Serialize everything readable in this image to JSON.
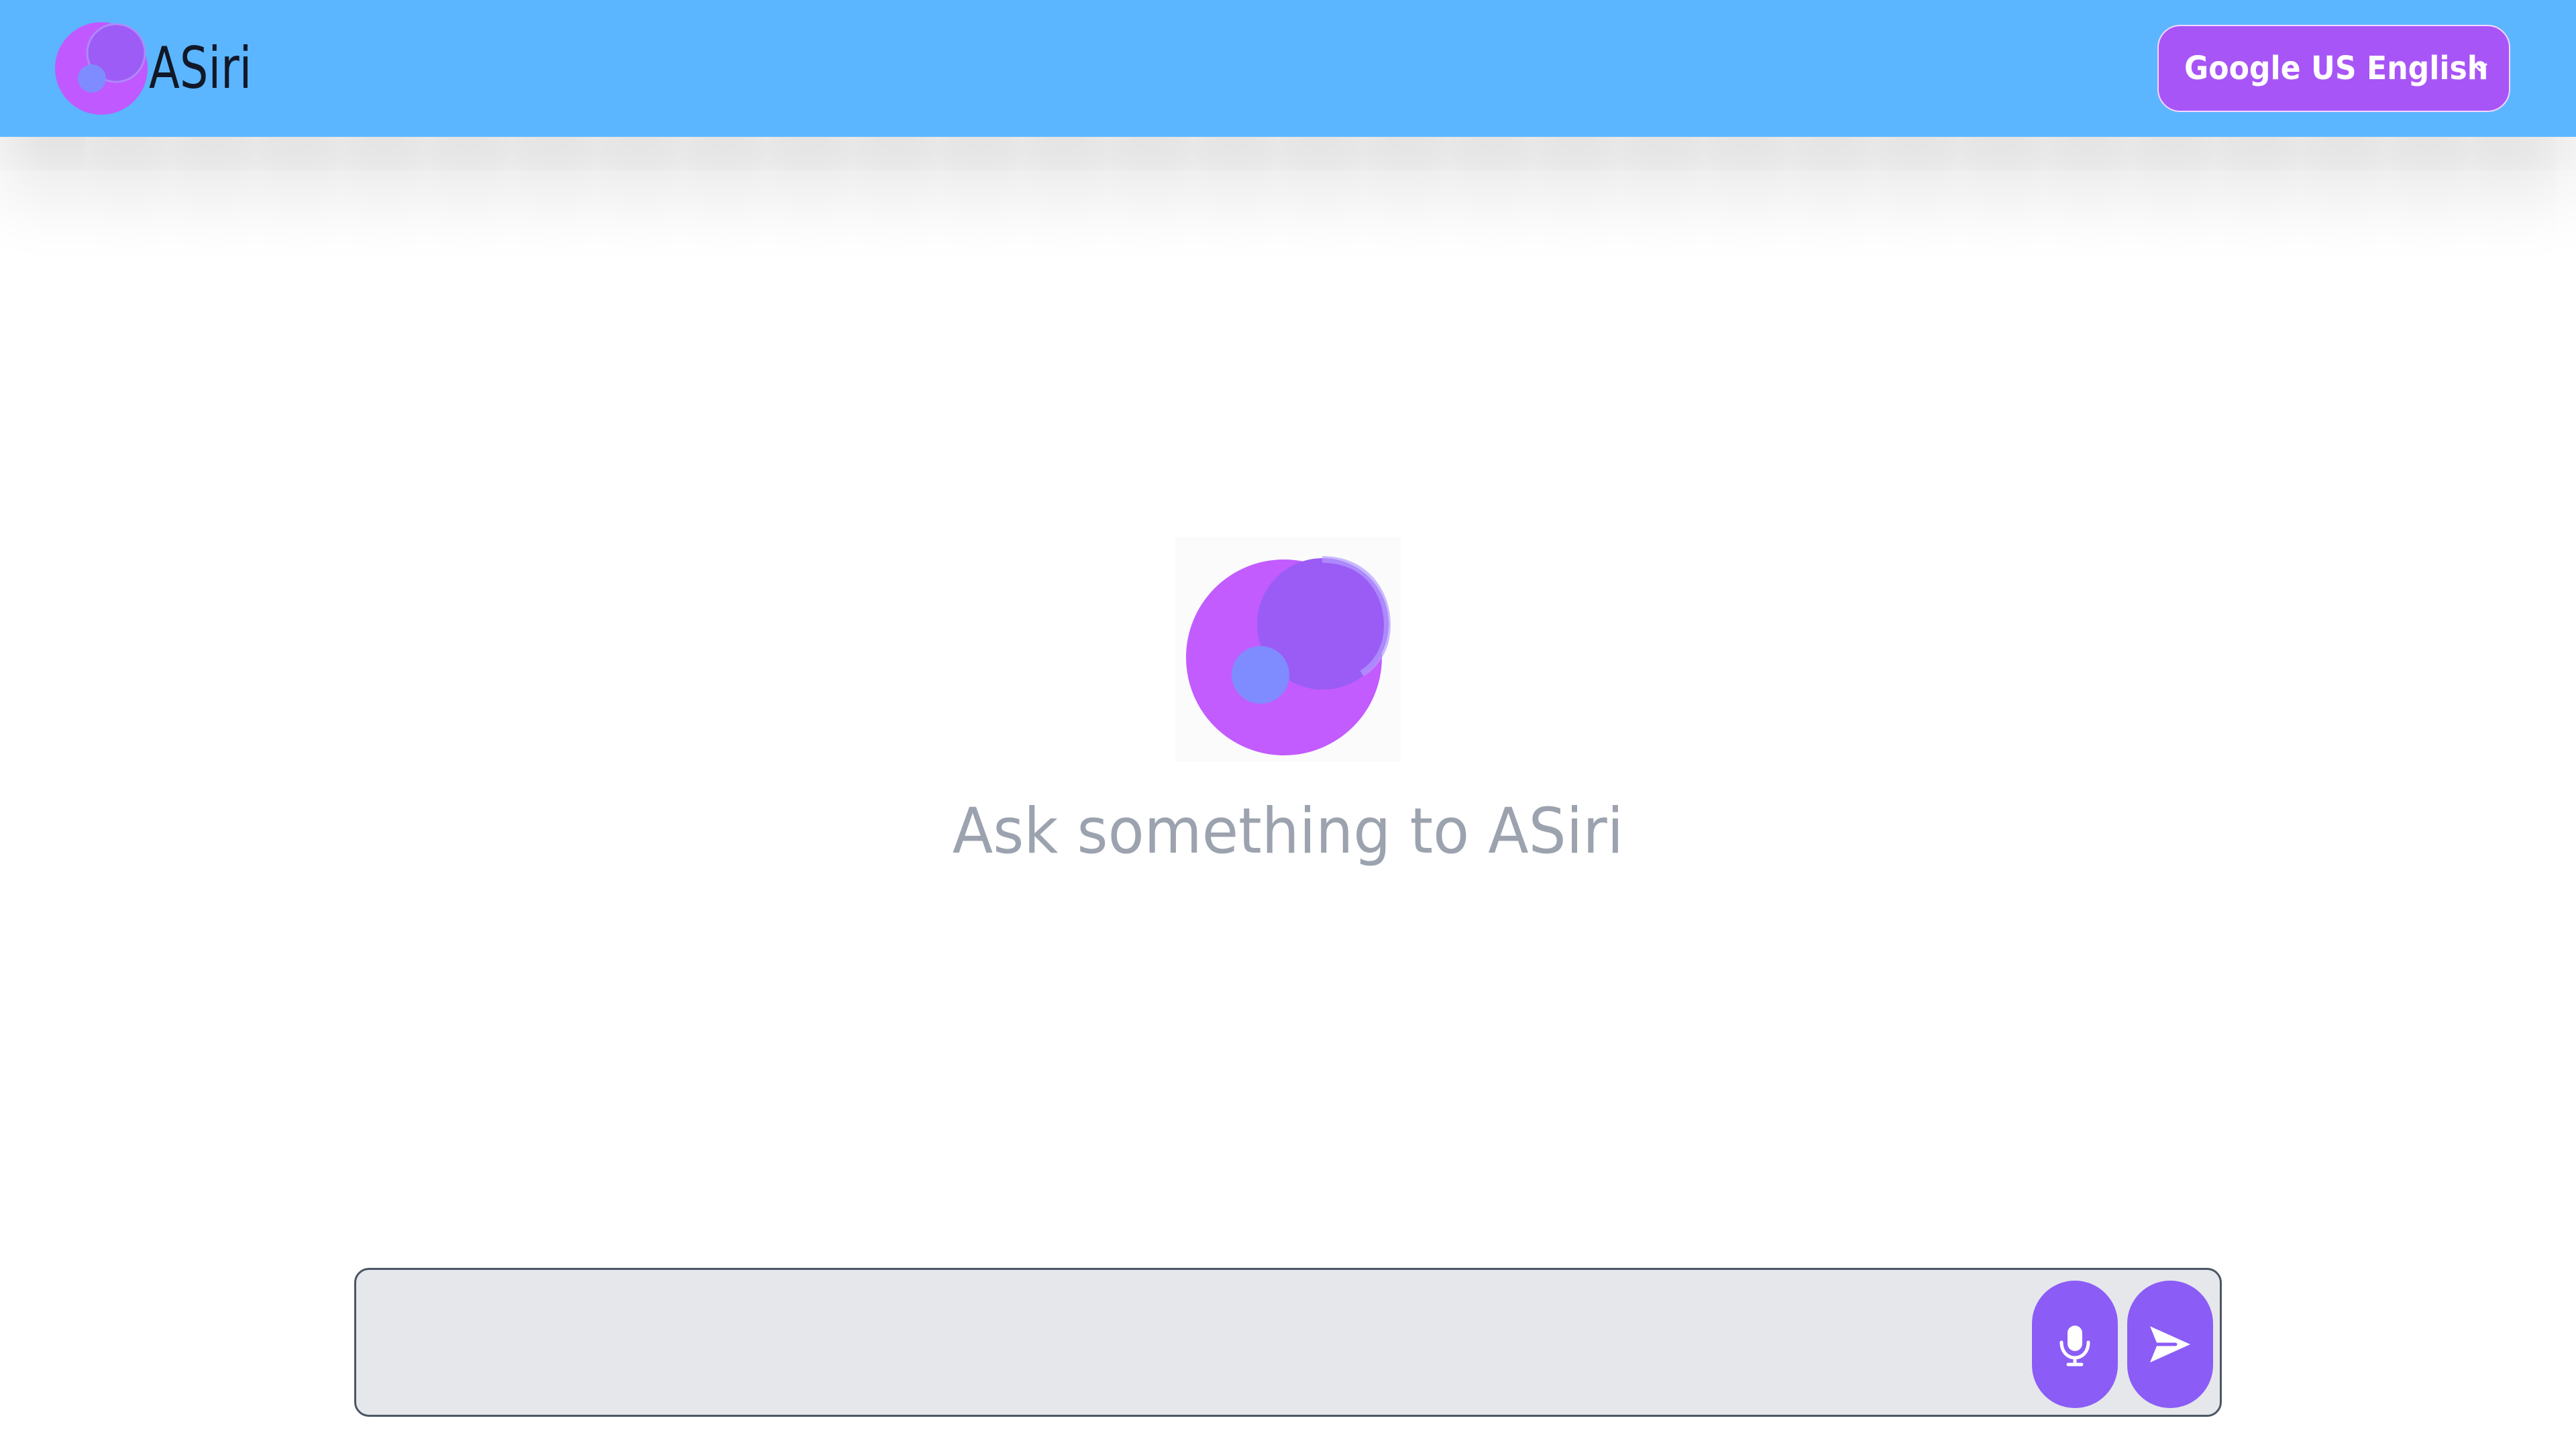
{
  "app": {
    "name": "ASiri"
  },
  "header": {
    "voice_select": {
      "selected": "Google US English"
    }
  },
  "hero": {
    "prompt": "Ask something to ASiri"
  },
  "composer": {
    "value": "",
    "placeholder": "",
    "microphone_icon": "microphone-icon",
    "send_icon": "send-icon"
  },
  "colors": {
    "header_background": "#5cb5ff",
    "accent_purple": "#a855f7",
    "button_purple": "#8b5cf6",
    "input_background": "#e5e7eb",
    "muted_text": "#9ca3af"
  }
}
